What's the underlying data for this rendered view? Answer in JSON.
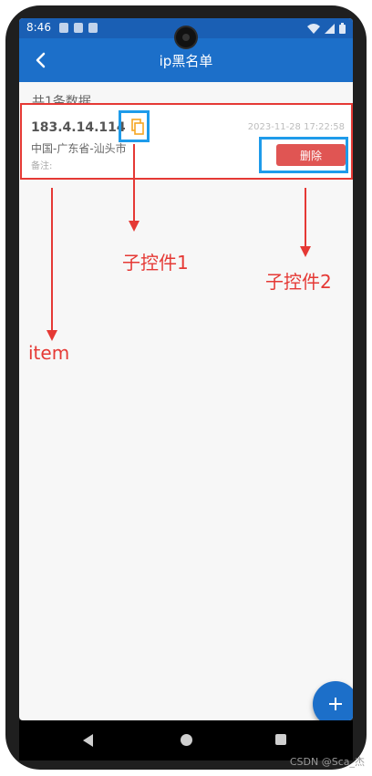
{
  "status_bar": {
    "time": "8:46"
  },
  "app_bar": {
    "title": "ip黑名单",
    "back_icon": "chevron-left-icon"
  },
  "list": {
    "summary": "共1条数据",
    "items": [
      {
        "ip": "183.4.14.114",
        "datetime": "2023-11-28 17:22:58",
        "region": "中国-广东省-汕头市",
        "remark_label": "备注:",
        "delete_label": "删除",
        "copy_icon": "copy-icon"
      }
    ]
  },
  "annotations": {
    "sub_control_1": "子控件1",
    "sub_control_2": "子控件2",
    "item": "item"
  },
  "fab": {
    "icon": "plus-icon"
  },
  "watermark": "CSDN @Sca_杰",
  "colors": {
    "primary": "#1c6fc9",
    "status_bar": "#1a5fb4",
    "delete_button": "#e05553",
    "annotation_red": "#e53935",
    "highlight_blue": "#1e9bea",
    "copy_icon": "#f5a623"
  }
}
